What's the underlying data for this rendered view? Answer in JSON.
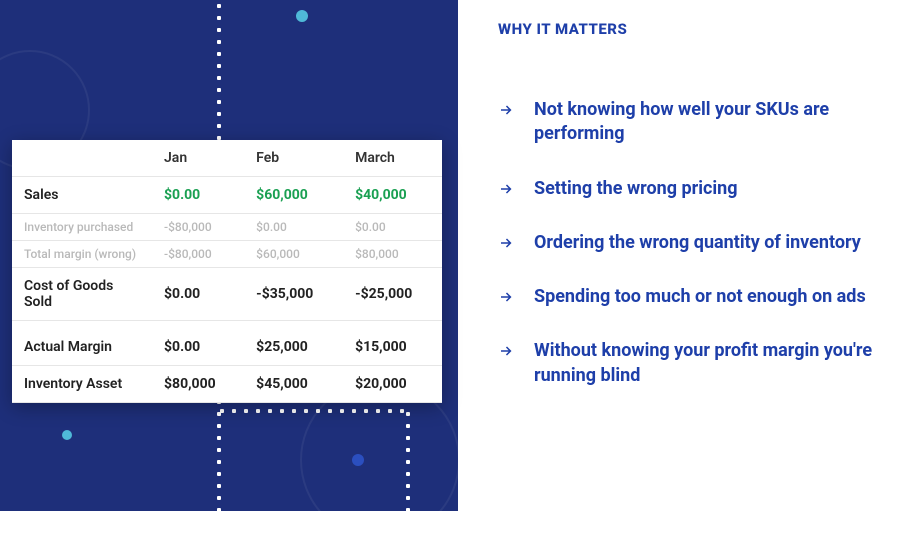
{
  "heading": "WHY IT MATTERS",
  "bullets": [
    "Not knowing how well your SKUs are performing",
    "Setting the wrong pricing",
    "Ordering the wrong quantity of inventory",
    "Spending too much or not enough on ads",
    "Without knowing your profit margin you're running blind"
  ],
  "table": {
    "columns": [
      "",
      "Jan",
      "Feb",
      "March"
    ],
    "rows": [
      {
        "label": "Sales",
        "values": [
          "$0.00",
          "$60,000",
          "$40,000"
        ],
        "style": "sales"
      },
      {
        "label": "Inventory purchased",
        "values": [
          "-$80,000",
          "$0.00",
          "$0.00"
        ],
        "style": "muted"
      },
      {
        "label": "Total margin (wrong)",
        "values": [
          "-$80,000",
          "$60,000",
          "$80,000"
        ],
        "style": "muted"
      },
      {
        "label": "Cost of Goods Sold",
        "values": [
          "$0.00",
          "-$35,000",
          "-$25,000"
        ],
        "style": "bold"
      },
      {
        "label": "Actual Margin",
        "values": [
          "$0.00",
          "$25,000",
          "$15,000"
        ],
        "style": "bold spacer"
      },
      {
        "label": "Inventory Asset",
        "values": [
          "$80,000",
          "$45,000",
          "$20,000"
        ],
        "style": "bold"
      }
    ]
  }
}
